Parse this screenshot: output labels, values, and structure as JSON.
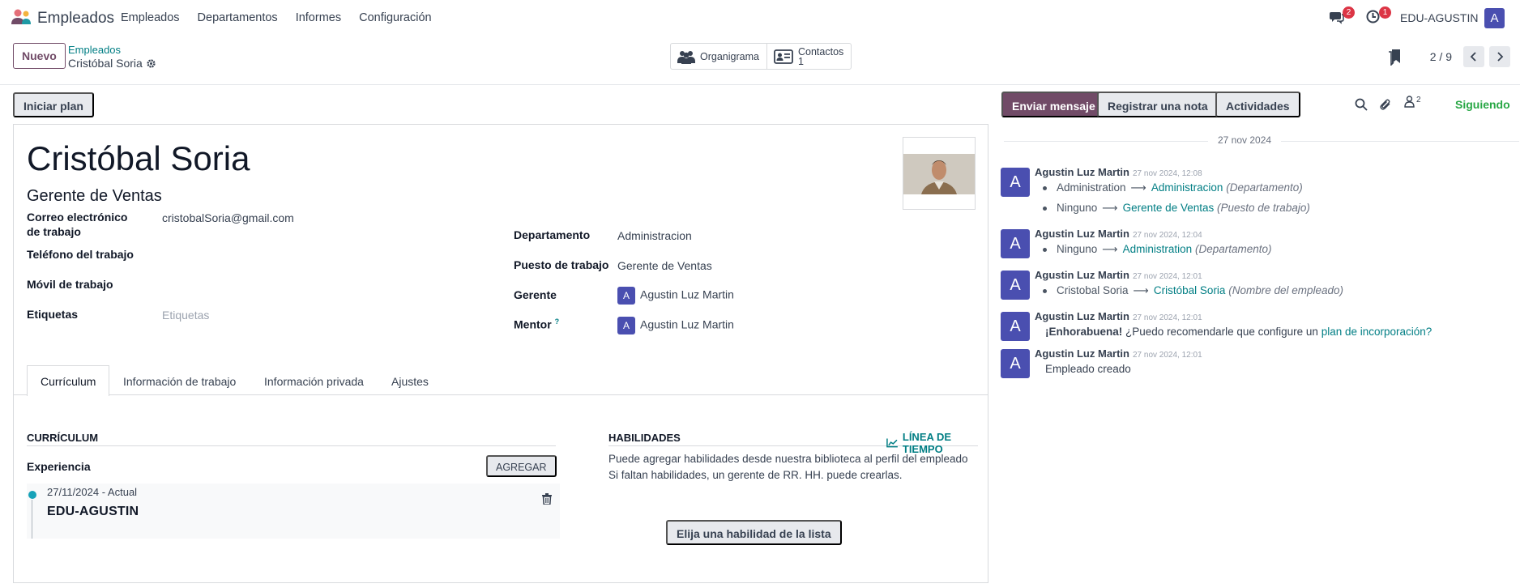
{
  "navbar": {
    "app_name": "Empleados",
    "menu": [
      "Empleados",
      "Departamentos",
      "Informes",
      "Configuración"
    ],
    "messages_badge": "2",
    "activities_badge": "1",
    "user_name": "EDU-AGUSTIN",
    "user_initial": "A"
  },
  "control": {
    "new_label": "Nuevo",
    "breadcrumb_parent": "Empleados",
    "breadcrumb_current": "Cristóbal Soria",
    "smart_org": "Organigrama",
    "smart_contacts_label": "Contactos",
    "smart_contacts_count": "1",
    "pager": "2 / 9"
  },
  "actions": {
    "plan_label": "Iniciar plan"
  },
  "employee": {
    "name": "Cristóbal Soria",
    "job_title": "Gerente de Ventas"
  },
  "fields_left": {
    "email_label": "Correo electrónico de trabajo",
    "email_value": "cristobalSoria@gmail.com",
    "phone_label": "Teléfono del trabajo",
    "mobile_label": "Móvil de trabajo",
    "tags_label": "Etiquetas",
    "tags_placeholder": "Etiquetas"
  },
  "fields_right": {
    "department_label": "Departamento",
    "department_value": "Administracion",
    "job_label": "Puesto de trabajo",
    "job_value": "Gerente de Ventas",
    "manager_label": "Gerente",
    "manager_value": "Agustin Luz Martin",
    "manager_initial": "A",
    "mentor_label": "Mentor",
    "mentor_help": "?",
    "mentor_value": "Agustin Luz Martin",
    "mentor_initial": "A"
  },
  "tabs": [
    "Currículum",
    "Información de trabajo",
    "Información privada",
    "Ajustes"
  ],
  "resume": {
    "title": "CURRÍCULUM",
    "experience_label": "Experiencia",
    "add_label": "AGREGAR",
    "entry_date": "27/11/2024 - Actual",
    "entry_company": "EDU-AGUSTIN"
  },
  "skills": {
    "title": "HABILIDADES",
    "timeline_label": "LÍNEA DE TIEMPO",
    "help_line1": "Puede agregar habilidades desde nuestra biblioteca al perfil del empleado",
    "help_line2": "Si faltan habilidades, un gerente de RR. HH. puede crearlas.",
    "pick_label": "Elija una habilidad de la lista"
  },
  "chatter": {
    "send_label": "Enviar mensaje",
    "note_label": "Registrar una nota",
    "activities_label": "Actividades",
    "followers_count": "2",
    "following_label": "Siguiendo",
    "date_separator": "27 nov 2024",
    "messages": [
      {
        "author": "Agustin Luz Martin",
        "time": "27 nov 2024, 12:08",
        "initial": "A",
        "tracking": [
          {
            "old": "Administration",
            "new": "Administracion",
            "field": "(Departamento)"
          },
          {
            "old": "Ninguno",
            "new": "Gerente de Ventas",
            "field": "(Puesto de trabajo)"
          }
        ]
      },
      {
        "author": "Agustin Luz Martin",
        "time": "27 nov 2024, 12:04",
        "initial": "A",
        "tracking": [
          {
            "old": "Ninguno",
            "new": "Administration",
            "field": "(Departamento)"
          }
        ]
      },
      {
        "author": "Agustin Luz Martin",
        "time": "27 nov 2024, 12:01",
        "initial": "A",
        "tracking": [
          {
            "old": "Cristobal Soria",
            "new": "Cristóbal Soria",
            "field": "(Nombre del empleado)"
          }
        ]
      },
      {
        "author": "Agustin Luz Martin",
        "time": "27 nov 2024, 12:01",
        "initial": "A",
        "body_bold": "¡Enhorabuena!",
        "body_text": "¿Puedo recomendarle que configure un",
        "body_link": "plan de incorporación?"
      },
      {
        "author": "Agustin Luz Martin",
        "time": "27 nov 2024, 12:01",
        "initial": "A",
        "body_text": "Empleado creado"
      }
    ]
  },
  "colors": {
    "brand": "#714b67",
    "link": "#017e84",
    "avatar": "#4a4fb0",
    "following": "#28a745",
    "badge": "#dc3545"
  }
}
